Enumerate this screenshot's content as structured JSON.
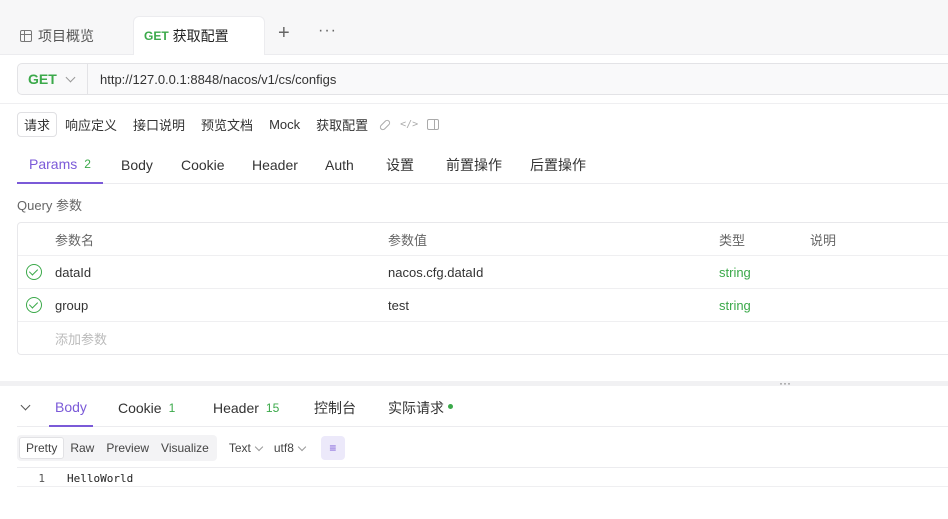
{
  "tabs": {
    "overview_label": "项目概览",
    "active_method": "GET",
    "active_label": "获取配置",
    "plus": "+",
    "more": "···"
  },
  "request": {
    "method": "GET",
    "url": "http://127.0.0.1:8848/nacos/v1/cs/configs"
  },
  "subtabs": {
    "request": "请求",
    "response_def": "响应定义",
    "api_doc": "接口说明",
    "preview_doc": "预览文档",
    "mock": "Mock",
    "name": "获取配置"
  },
  "param_tabs": {
    "params": "Params",
    "params_count": "2",
    "body": "Body",
    "cookie": "Cookie",
    "header": "Header",
    "auth": "Auth",
    "settings": "设置",
    "pre_ops": "前置操作",
    "post_ops": "后置操作"
  },
  "query": {
    "label": "Query 参数",
    "headers": {
      "name": "参数名",
      "value": "参数值",
      "type": "类型",
      "desc": "说明"
    },
    "rows": [
      {
        "name": "dataId",
        "value": "nacos.cfg.dataId",
        "type": "string",
        "desc": ""
      },
      {
        "name": "group",
        "value": "test",
        "type": "string",
        "desc": ""
      }
    ],
    "add_placeholder": "添加参数"
  },
  "splitter_dots": "···",
  "response_tabs": {
    "body": "Body",
    "cookie": "Cookie",
    "cookie_count": "1",
    "header": "Header",
    "header_count": "15",
    "console": "控制台",
    "actual_request": "实际请求"
  },
  "format": {
    "pretty": "Pretty",
    "raw": "Raw",
    "preview": "Preview",
    "visualize": "Visualize",
    "text": "Text",
    "encoding": "utf8"
  },
  "response_body": {
    "line_number": "1",
    "content": "HelloWorld"
  },
  "colors": {
    "accent": "#7b5ad8",
    "method_get": "#3ba94a"
  }
}
